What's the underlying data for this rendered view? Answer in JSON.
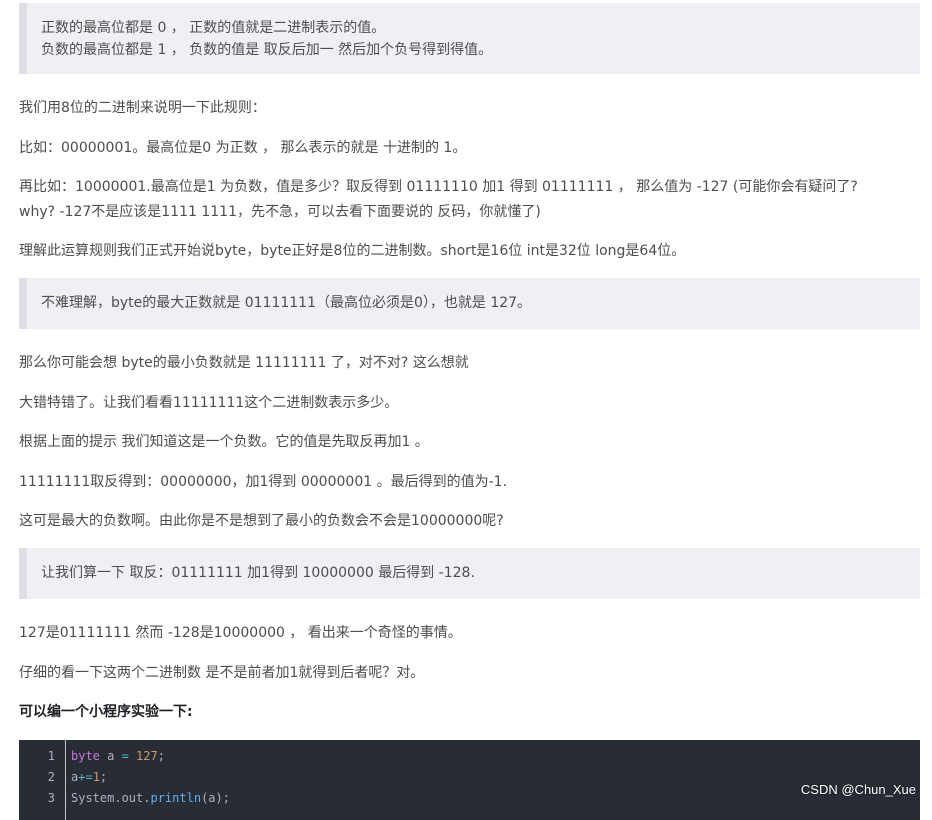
{
  "quote1": {
    "line1": "正数的最高位都是 0 ， 正数的值就是二进制表示的值。",
    "line2": "负数的最高位都是 1 ， 负数的值是 取反后加一 然后加个负号得到得值。"
  },
  "p1": "我们用8位的二进制来说明一下此规则：",
  "p2": "比如：00000001。最高位是0 为正数 ， 那么表示的就是 十进制的 1。",
  "p3_line1": "再比如：10000001.最高位是1 为负数，值是多少？取反得到 01111110 加1 得到 01111111 ， 那么值为 -127 (可能你会有疑问了?",
  "p3_line2": "why? -127不是应该是1111 1111，先不急，可以去看下面要说的 反码，你就懂了)",
  "p4": "理解此运算规则我们正式开始说byte，byte正好是8位的二进制数。short是16位 int是32位 long是64位。",
  "quote2": "不难理解，byte的最大正数就是 01111111（最高位必须是0），也就是 127。",
  "p5": "那么你可能会想 byte的最小负数就是 11111111 了，对不对? 这么想就",
  "p6": "大错特错了。让我们看看11111111这个二进制数表示多少。",
  "p7": "根据上面的提示 我们知道这是一个负数。它的值是先取反再加1 。",
  "p8": "11111111取反得到：00000000，加1得到 00000001 。最后得到的值为-1.",
  "p9": "这可是最大的负数啊。由此你是不是想到了最小的负数会不会是10000000呢?",
  "quote3": "让我们算一下 取反：01111111 加1得到 10000000 最后得到 -128.",
  "p10": "127是01111111 然而 -128是10000000 ， 看出来一个奇怪的事情。",
  "p11": "仔细的看一下这两个二进制数 是不是前者加1就得到后者呢？对。",
  "p12": "可以编一个小程序实验一下:",
  "code": {
    "line_numbers": [
      "1",
      "2",
      "3"
    ],
    "l1": {
      "kw": "byte",
      "var": " a ",
      "op": "=",
      "num": " 127",
      "end": ";"
    },
    "l2": {
      "var": "a",
      "op": "+=",
      "num": "1",
      "end": ";"
    },
    "l3": {
      "obj": "System.out.",
      "fn": "println",
      "args": "(a);"
    }
  },
  "watermark": "CSDN @Chun_Xue",
  "colors": {
    "quote_bg": "#eef0f4",
    "quote_border": "#dddfe4",
    "code_bg": "#282c34",
    "keyword": "#c678dd",
    "number": "#d19a66",
    "function": "#61aeee"
  }
}
